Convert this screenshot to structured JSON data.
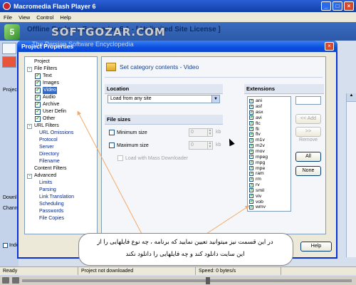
{
  "player": {
    "title": "Macromedia Flash Player 6",
    "menu": [
      "File",
      "View",
      "Control",
      "Help"
    ]
  },
  "app": {
    "title": "Offline Explorer Enterprise 5.1 - [ Unlimited Site License ]",
    "tabs": {
      "project": "Projec",
      "download": "Downl",
      "channel": "Channe"
    },
    "index_label": "Index dov",
    "status": {
      "ready": "Ready",
      "project": "Project not downloaded",
      "speed": "Speed: 0 bytes/s"
    }
  },
  "watermark": {
    "brand": "SOFTGOZAR.COM",
    "sub": "The Persian Software Encyclopedia"
  },
  "dialog": {
    "title": "Project Properties",
    "help_label": "Help",
    "tree": [
      {
        "label": "Project",
        "level": 0,
        "exp": ""
      },
      {
        "label": "File Filters",
        "level": 0,
        "exp": "-"
      },
      {
        "label": "Text",
        "level": 1,
        "checked": true
      },
      {
        "label": "Images",
        "level": 1,
        "checked": true
      },
      {
        "label": "Video",
        "level": 1,
        "checked": true,
        "selected": true
      },
      {
        "label": "Audio",
        "level": 1,
        "checked": true
      },
      {
        "label": "Archive",
        "level": 1,
        "checked": true
      },
      {
        "label": "User Defin",
        "level": 1,
        "checked": true
      },
      {
        "label": "Other",
        "level": 1,
        "checked": true
      },
      {
        "label": "URL Filters",
        "level": 0,
        "exp": "-"
      },
      {
        "label": "URL Omissions",
        "level": 2
      },
      {
        "label": "Protocol",
        "level": 2
      },
      {
        "label": "Server",
        "level": 2
      },
      {
        "label": "Directory",
        "level": 2
      },
      {
        "label": "Filename",
        "level": 2
      },
      {
        "label": "Content Filters",
        "level": 0,
        "exp": ""
      },
      {
        "label": "Advanced",
        "level": 0,
        "exp": "-"
      },
      {
        "label": "Limits",
        "level": 2
      },
      {
        "label": "Parsing",
        "level": 2
      },
      {
        "label": "Link Translation",
        "level": 2
      },
      {
        "label": "Scheduling",
        "level": 2
      },
      {
        "label": "Passwords",
        "level": 2
      },
      {
        "label": "File Copies",
        "level": 2
      }
    ],
    "panel": {
      "heading": "Set category contents - Video",
      "location_label": "Location",
      "location_value": "Load from any site",
      "filesizes_label": "File sizes",
      "min_label": "Minimum size",
      "max_label": "Maximum size",
      "min_value": "0",
      "max_value": "0",
      "unit": "kb",
      "mass_label": "Load with Mass Downloader",
      "extensions_label": "Extensions",
      "extensions": [
        "ani",
        "asf",
        "asx",
        "avi",
        "flc",
        "fli",
        "flv",
        "m1v",
        "m2v",
        "mov",
        "mpeg",
        "mpg",
        "mpe",
        "ram",
        "rm",
        "rv",
        "smil",
        "viv",
        "vob",
        "wmv"
      ],
      "add_label": "<< Add",
      "remove_label": ">> Remove",
      "all_label": "All",
      "none_label": "None"
    }
  },
  "annotation": {
    "line1": "در این قسمت نیز میتوانید تعیین نمایید که برنامه ، چه نوع فایلهایی را از",
    "line2": "این سایت دانلود کند و چه فایلهایی را دانلود نکند"
  }
}
